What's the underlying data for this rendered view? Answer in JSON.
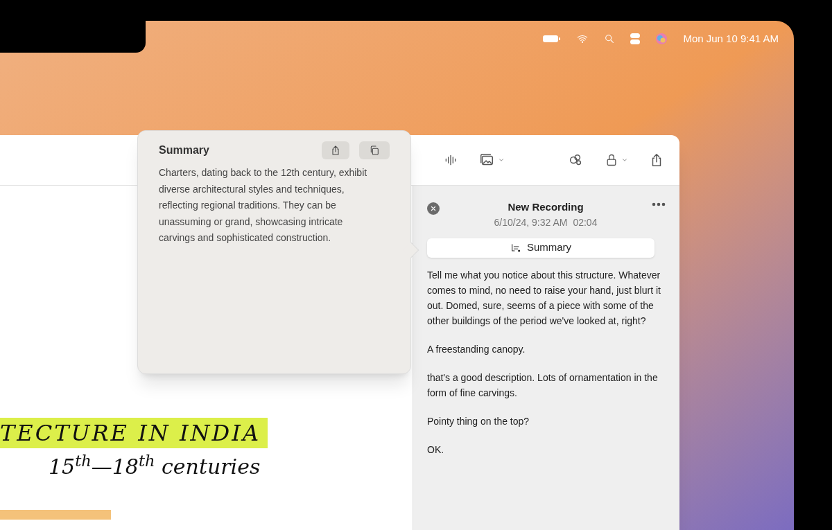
{
  "menu_bar": {
    "clock": "Mon Jun 10 9:41 AM"
  },
  "summary_popover": {
    "title": "Summary",
    "text": "Charters, dating back to the 12th century, exhibit diverse architectural styles and techniques, reflecting regional traditions. They can be unassuming or grand, showcasing intricate carvings and sophisticated construction."
  },
  "recording": {
    "title": "New Recording",
    "date": "6/10/24, 9:32 AM",
    "duration": "02:04",
    "summary_button": "Summary",
    "transcript": [
      "Tell me what you notice about this structure. Whatever comes to mind, no need to raise your hand, just blurt it out. Domed, sure, seems of a piece with some of the other buildings of the period we've looked at, right?",
      "A freestanding canopy.",
      "that's a good description. Lots of ornamentation in the form of fine carvings.",
      "Pointy thing on the top?",
      "OK."
    ]
  },
  "note": {
    "heading": "TECTURE IN INDIA",
    "subheading": "15$^{th}$—18$^{th}$ centuries"
  }
}
